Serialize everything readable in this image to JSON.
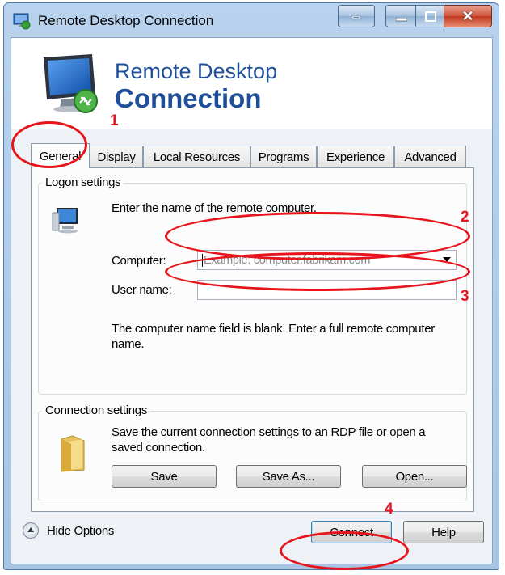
{
  "window": {
    "title": "Remote Desktop Connection",
    "banner_line1": "Remote Desktop",
    "banner_line2": "Connection",
    "controls": [
      "swap-arrows",
      "minimize",
      "maximize",
      "close"
    ]
  },
  "tabs": [
    {
      "label": "General",
      "active": true
    },
    {
      "label": "Display",
      "active": false
    },
    {
      "label": "Local Resources",
      "active": false
    },
    {
      "label": "Programs",
      "active": false
    },
    {
      "label": "Experience",
      "active": false
    },
    {
      "label": "Advanced",
      "active": false
    }
  ],
  "logon": {
    "group_label": "Logon settings",
    "instruction": "Enter the name of the remote computer.",
    "computer_label": "Computer:",
    "computer_placeholder": "Example: computer.fabrikam.com",
    "computer_value": "",
    "username_label": "User name:",
    "username_value": "",
    "hint": "The computer name field is blank. Enter a full remote computer name."
  },
  "connection": {
    "group_label": "Connection settings",
    "description": "Save the current connection settings to an RDP file or open a saved connection.",
    "save_label": "Save",
    "save_as_label": "Save As...",
    "open_label": "Open..."
  },
  "footer": {
    "hide_options_label": "Hide Options",
    "connect_label": "Connect",
    "help_label": "Help"
  },
  "annotations": [
    "1",
    "2",
    "3",
    "4"
  ],
  "colors": {
    "annotation": "#e8141b",
    "banner_text": "#1f4e9b",
    "frame": "#b9d3ee"
  },
  "icons": [
    "rdc-app-icon",
    "rdc-monitor-logo-icon",
    "computer-icon",
    "folder-icon",
    "hide-options-chevron-icon"
  ]
}
